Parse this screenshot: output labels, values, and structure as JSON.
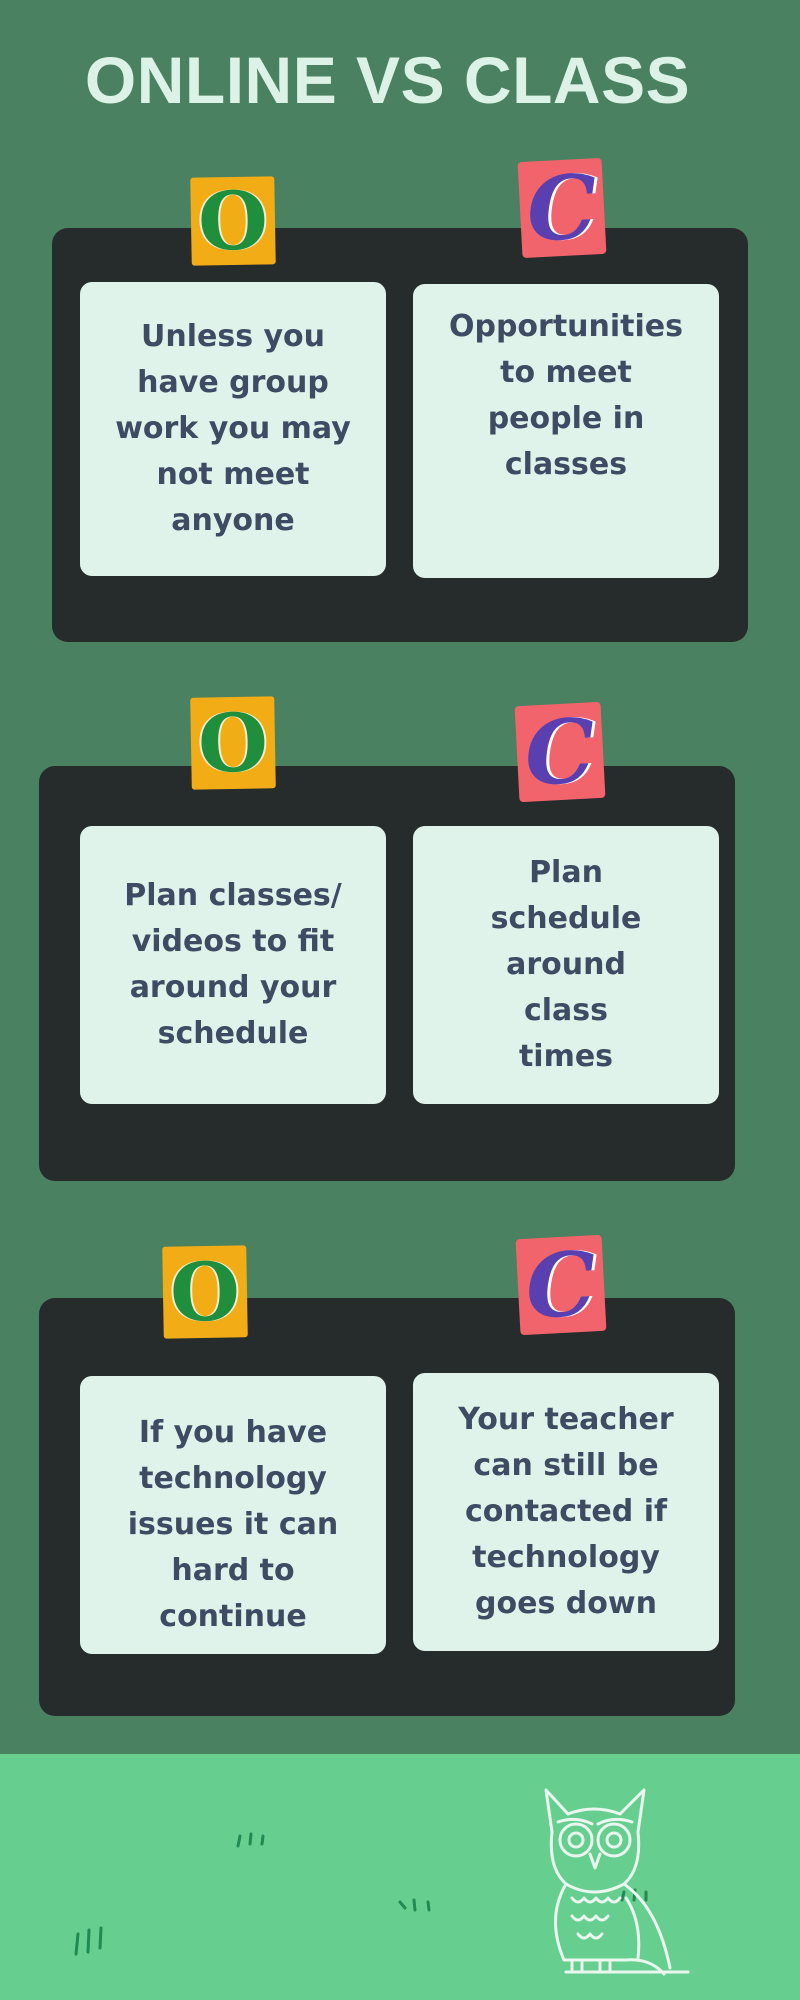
{
  "page": {
    "title": "ONLINE VS CLASS"
  },
  "stamps": {
    "online_letter": "O",
    "class_letter": "C"
  },
  "comparisons": [
    {
      "online": "Unless you have group work you may not meet anyone",
      "class": "Opportunities to meet people in classes"
    },
    {
      "online": "Plan classes/ videos to fit around your schedule",
      "class": "Plan schedule around class times"
    },
    {
      "online": "If you have technology issues it can hard to continue",
      "class": "Your teacher can still be contacted if technology goes down"
    }
  ],
  "colors": {
    "background": "#4a8160",
    "panel": "#262c2c",
    "card": "#dff3ea",
    "card_text": "#3f4a63",
    "stamp_online": "#f2ad16",
    "stamp_class": "#f2646b",
    "ground": "#66cf90"
  },
  "decorations": {
    "mascot_icon": "owl-icon",
    "grass_icon": "grass-tuft-icon"
  }
}
